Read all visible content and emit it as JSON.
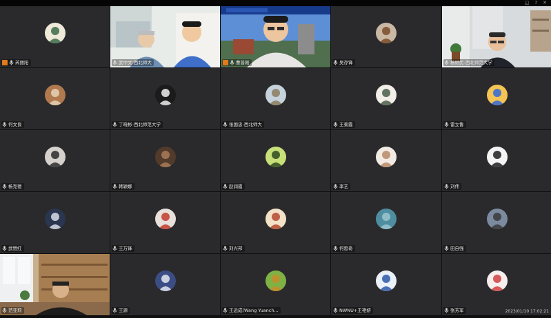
{
  "top_icons": [
    "share-icon",
    "help-icon",
    "close-icon"
  ],
  "timestamp": "2023/01/10 17:02:21",
  "participants": [
    {
      "name": "芮丽阳",
      "badge": "host",
      "avatar": {
        "bg": "#efe9d8",
        "fg": "#3a6b4a"
      }
    },
    {
      "name": "武中文-西北师大",
      "video": "two-men"
    },
    {
      "name": "曹普刚",
      "badge": "host",
      "video": "speaker"
    },
    {
      "name": "吴存锋",
      "avatar": {
        "bg": "#c9b8a4",
        "fg": "#7a4b2a"
      }
    },
    {
      "name": "杨继民-西北师范大学",
      "video": "office"
    },
    {
      "name": "何文良",
      "avatar": {
        "bg": "#b07a4e",
        "fg": "#e7d2b8"
      }
    },
    {
      "name": "丁晓彬-西北师范大学",
      "avatar": {
        "bg": "#1b1b1b",
        "fg": "#f0f0f0"
      }
    },
    {
      "name": "张国忠-西北师大",
      "avatar": {
        "bg": "#c7d3dc",
        "fg": "#8a7d5e"
      }
    },
    {
      "name": "王菊霞",
      "avatar": {
        "bg": "#f1efe8",
        "fg": "#4b5d4a"
      }
    },
    {
      "name": "雷立鲁",
      "avatar": {
        "bg": "#f4c454",
        "fg": "#2f6ad9"
      }
    },
    {
      "name": "杨克德",
      "avatar": {
        "bg": "#d6d1cc",
        "fg": "#2c2c2c"
      }
    },
    {
      "name": "韩颖娜",
      "avatar": {
        "bg": "#523b2a",
        "fg": "#a97d5a"
      }
    },
    {
      "name": "赵润霞",
      "avatar": {
        "bg": "#c8e07a",
        "fg": "#2d4a1e"
      }
    },
    {
      "name": "李艺",
      "avatar": {
        "bg": "#f2ebe3",
        "fg": "#b88a6a"
      }
    },
    {
      "name": "刘伟",
      "avatar": {
        "bg": "#f4f4f4",
        "fg": "#1e1e1e"
      }
    },
    {
      "name": "武赞红",
      "avatar": {
        "bg": "#2a3550",
        "fg": "#d8dde8"
      }
    },
    {
      "name": "王万锋",
      "avatar": {
        "bg": "#e7e0db",
        "fg": "#c13b2b"
      }
    },
    {
      "name": "刘兴邦",
      "avatar": {
        "bg": "#f4e2c8",
        "fg": "#b5482f"
      }
    },
    {
      "name": "何思奇",
      "avatar": {
        "bg": "#4f8ea0",
        "fg": "#9cc6cf"
      }
    },
    {
      "name": "田自强",
      "avatar": {
        "bg": "#7c8aa0",
        "fg": "#3a3a3a"
      }
    },
    {
      "name": "范亚莉",
      "video": "library"
    },
    {
      "name": "王源",
      "avatar": {
        "bg": "#3b4d84",
        "fg": "#e4e8f2"
      }
    },
    {
      "name": "王远成(Wang Yuanch...",
      "avatar": {
        "bg": "#7fb244",
        "fg": "#c98b2b"
      }
    },
    {
      "name": "NWNU+王艳妍",
      "avatar": {
        "bg": "#eaf1f8",
        "fg": "#2e58a8"
      }
    },
    {
      "name": "张芳军",
      "avatar": {
        "bg": "#f7eeee",
        "fg": "#d04040"
      }
    }
  ]
}
